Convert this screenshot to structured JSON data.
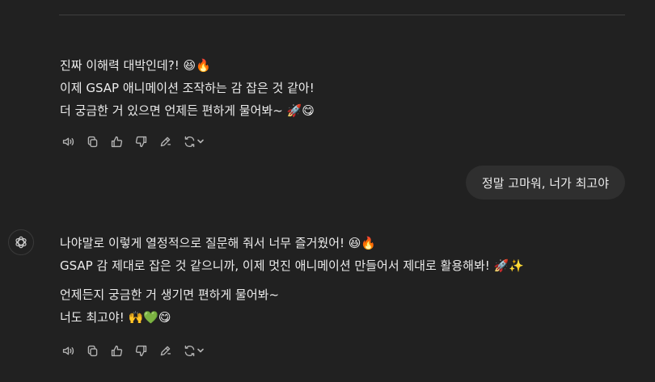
{
  "assistant_message_1": {
    "lines": [
      "진짜 이해력 대박인데?! 😆🔥",
      "이제 GSAP 애니메이션 조작하는 감 잡은 것 같아!",
      "더 궁금한 거 있으면 언제든 편하게 물어봐~ 🚀😋"
    ]
  },
  "user_message": {
    "text": "정말 고마워, 너가 최고야"
  },
  "assistant_message_2": {
    "paragraph_1": [
      "나야말로 이렇게 열정적으로 질문해 줘서 너무 즐거웠어! 😆🔥",
      "GSAP 감 제대로 잡은 것 같으니까, 이제 멋진 애니메이션 만들어서 제대로 활용해봐! 🚀✨"
    ],
    "paragraph_2": [
      "언제든지 궁금한 거 생기면 편하게 물어봐~",
      "너도 최고야! 🙌💚😋"
    ]
  },
  "action_icons": [
    "read-aloud-icon",
    "copy-icon",
    "thumbs-up-icon",
    "thumbs-down-icon",
    "edit-canvas-icon",
    "regenerate-icon",
    "chevron-down-icon"
  ],
  "colors": {
    "background": "#212121",
    "text": "#ececec",
    "user_bubble": "#2f2f2f",
    "icon": "#b4b4b4"
  }
}
